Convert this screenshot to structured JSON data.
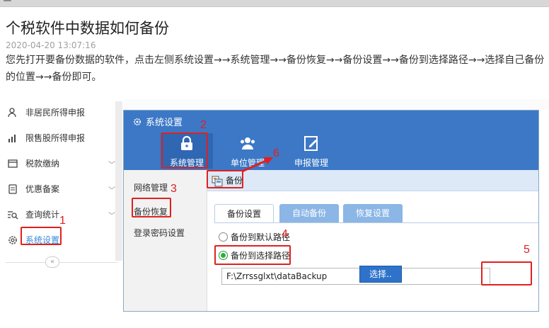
{
  "article": {
    "title": "个税软件中数据如何备份",
    "date": "2020-04-20 13:07:16",
    "body": "您先打开要备份数据的软件，点击左侧系统设置→→系统管理→→备份恢复→→备份设置→→备份到选择路径→→选择自己备份的位置→→备份即可。"
  },
  "left_nav": {
    "items": [
      {
        "label": "非居民所得申报",
        "icon": "user-icon"
      },
      {
        "label": "限售股所得申报",
        "icon": "bar-chart-icon"
      },
      {
        "label": "税款缴纳",
        "icon": "wallet-icon"
      },
      {
        "label": "优惠备案",
        "icon": "document-icon"
      },
      {
        "label": "查询统计",
        "icon": "search-list-icon"
      },
      {
        "label": "系统设置",
        "icon": "gear-icon"
      }
    ],
    "collapse_icon": "«"
  },
  "window": {
    "title": "系统设置",
    "modules": [
      {
        "label": "系统管理",
        "icon": "lock-icon"
      },
      {
        "label": "单位管理",
        "icon": "users-icon"
      },
      {
        "label": "申报管理",
        "icon": "edit-icon"
      }
    ],
    "side_menu": [
      "网络管理",
      "备份恢复",
      "登录密码设置"
    ],
    "toolbar": {
      "backup_label": "备份"
    },
    "tabs": [
      "备份设置",
      "自动备份",
      "恢复设置"
    ],
    "options": {
      "default_path": "备份到默认路径",
      "choose_path": "备份到选择路径"
    },
    "path_value": "F:\\Zrrssglxt\\dataBackup",
    "select_button": "选择.."
  },
  "annotations": {
    "n1": "1",
    "n2": "2",
    "n3": "3",
    "n4": "4",
    "n5": "5",
    "n6": "6",
    "color": "#e02020"
  },
  "colors": {
    "window_header": "#3c78c6",
    "accent": "#3a86d6",
    "tab_inactive": "#8bb6e6",
    "radio_checked": "#2fae40"
  }
}
